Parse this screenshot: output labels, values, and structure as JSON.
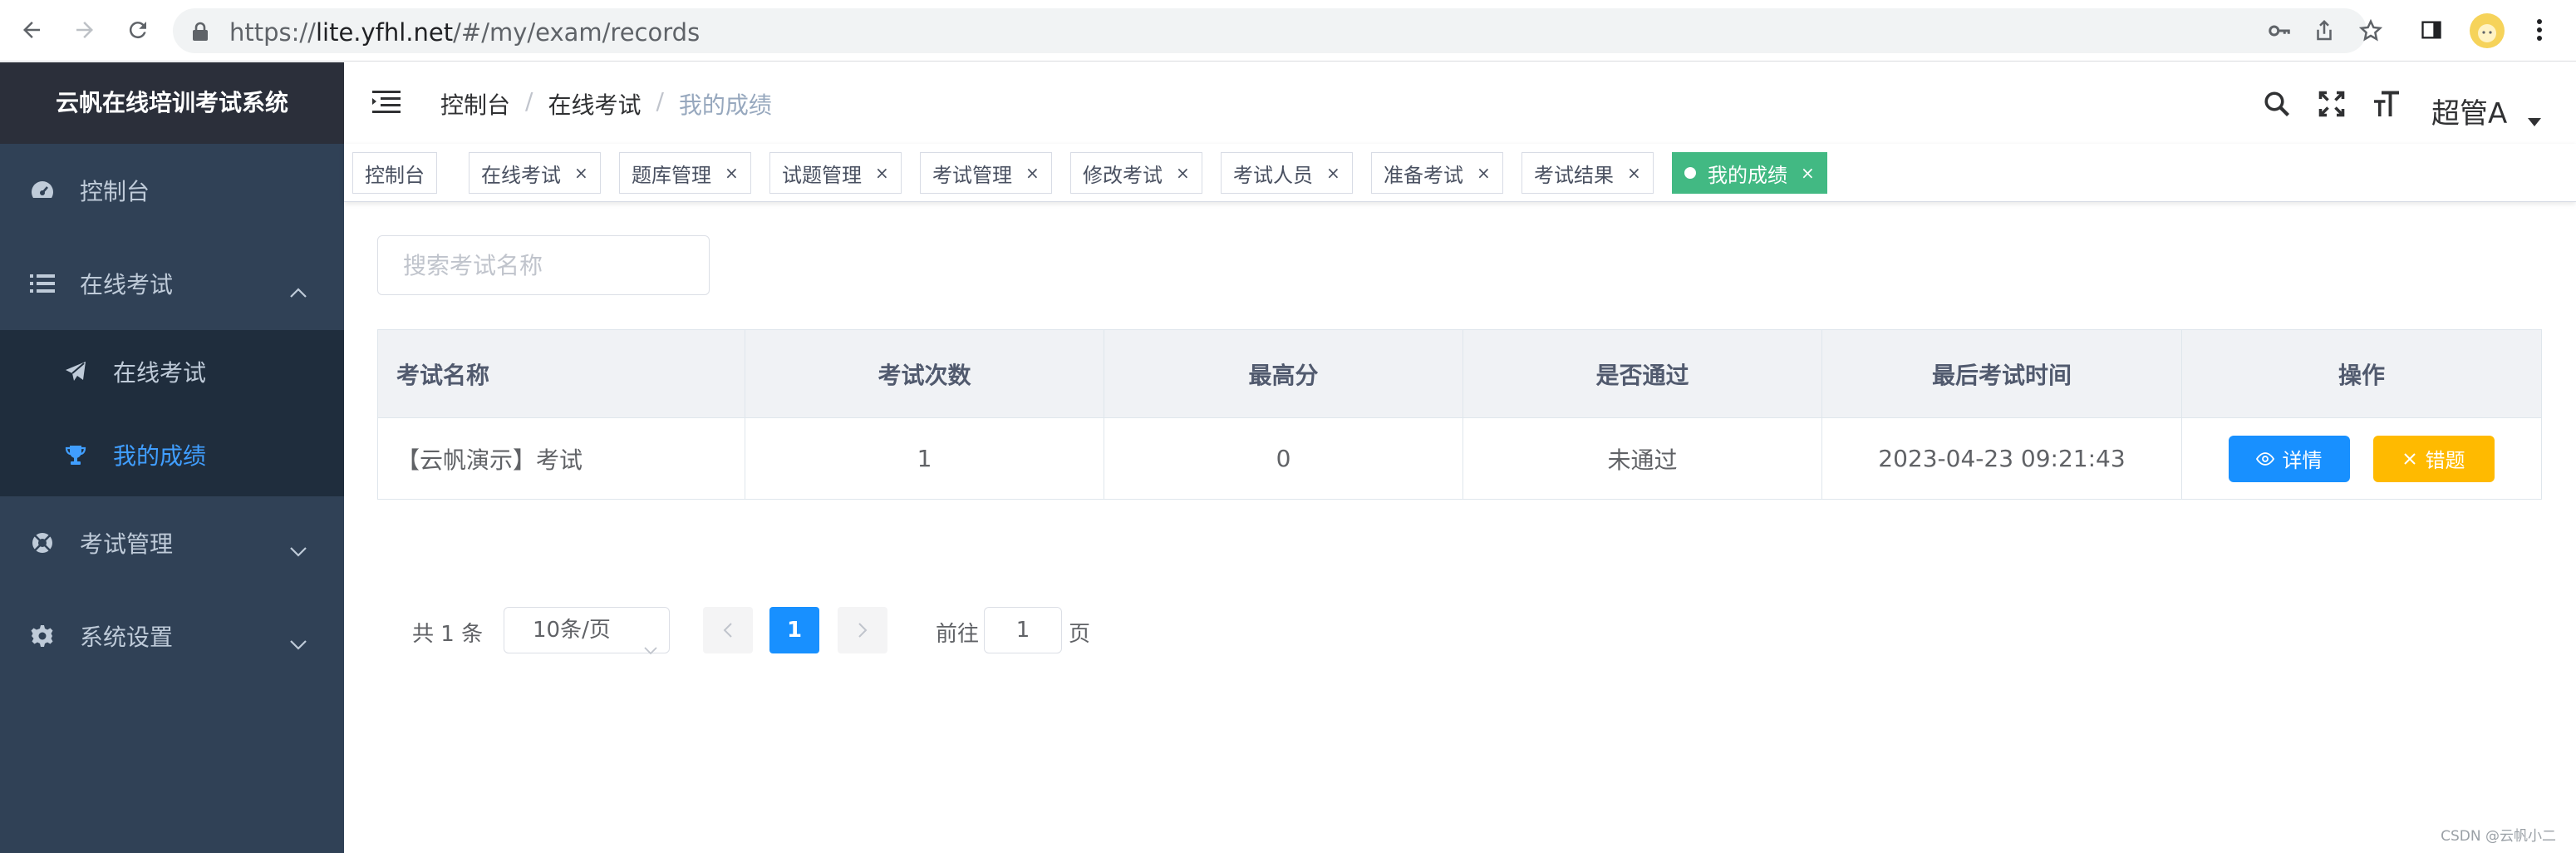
{
  "browser": {
    "url_scheme": "https://",
    "url_host": "lite.yfhl.net",
    "url_path": "/#/my/exam/records"
  },
  "sidebar": {
    "title": "云帆在线培训考试系统",
    "items": [
      {
        "label": "控制台",
        "icon": "dashboard-icon"
      },
      {
        "label": "在线考试",
        "icon": "list-icon",
        "expanded": true,
        "children": [
          {
            "label": "在线考试",
            "icon": "paper-plane-icon"
          },
          {
            "label": "我的成绩",
            "icon": "trophy-icon",
            "active": true
          }
        ]
      },
      {
        "label": "考试管理",
        "icon": "lifebuoy-icon"
      },
      {
        "label": "系统设置",
        "icon": "gear-icon"
      }
    ],
    "active_color": "#409eff"
  },
  "navbar": {
    "breadcrumb": [
      "控制台",
      "在线考试",
      "我的成绩"
    ],
    "separator": "/",
    "user": "超管A"
  },
  "tags": [
    {
      "label": "控制台"
    },
    {
      "label": "在线考试",
      "close": "×"
    },
    {
      "label": "题库管理",
      "close": "×"
    },
    {
      "label": "试题管理",
      "close": "×"
    },
    {
      "label": "考试管理",
      "close": "×"
    },
    {
      "label": "修改考试",
      "close": "×"
    },
    {
      "label": "考试人员",
      "close": "×"
    },
    {
      "label": "准备考试",
      "close": "×"
    },
    {
      "label": "考试结果",
      "close": "×"
    },
    {
      "label": "我的成绩",
      "close": "×",
      "active": true
    }
  ],
  "search": {
    "placeholder": "搜索考试名称"
  },
  "table": {
    "headers": [
      "考试名称",
      "考试次数",
      "最高分",
      "是否通过",
      "最后考试时间",
      "操作"
    ],
    "rows": [
      {
        "name": "【云帆演示】考试",
        "tries": "1",
        "max_score": "0",
        "passed": "未通过",
        "last_time": "2023-04-23 09:21:43"
      }
    ],
    "actions": {
      "detail": "详情",
      "wrong": "错题"
    }
  },
  "pagination": {
    "total": "共 1 条",
    "page_size": "10条/页",
    "current": "1",
    "goto_label": "前往",
    "goto_value": "1",
    "page_suffix": "页"
  },
  "watermark": "CSDN @云帆小二",
  "colors": {
    "sidebar_bg": "#304156",
    "primary": "#1890ff",
    "warning": "#ffba00",
    "tag_active": "#42b983",
    "fail": "#e6000f"
  }
}
